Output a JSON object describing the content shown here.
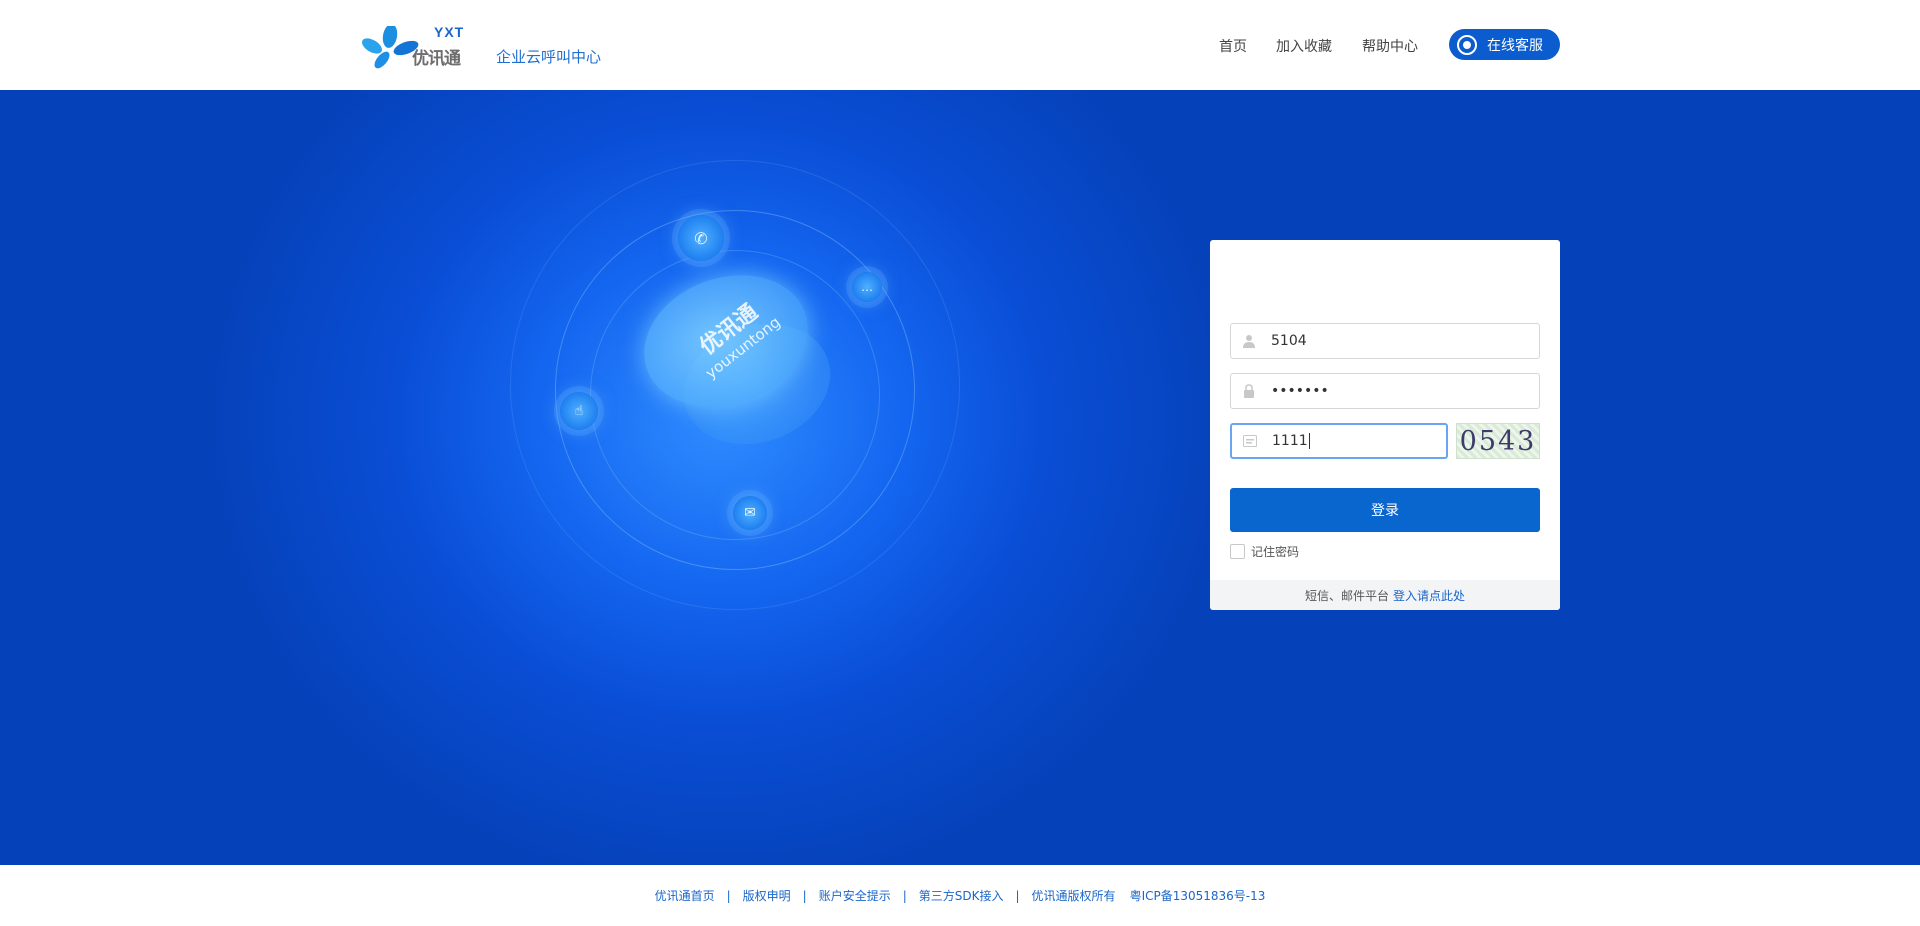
{
  "header": {
    "logo_mark": "YXT",
    "logo_cn": "优讯通",
    "subtitle": "企业云呼叫中心",
    "nav": [
      "首页",
      "加入收藏",
      "帮助中心"
    ],
    "service_button": "在线客服"
  },
  "hero": {
    "brand_cn": "优讯通",
    "brand_en": "youxuntong"
  },
  "login": {
    "username_value": "5104",
    "password_value": "•••••••",
    "captcha_input_value": "1111",
    "captcha_image_text": "0543",
    "submit_label": "登录",
    "remember_label": "记住密码",
    "footer_text": "短信、邮件平台",
    "footer_link": "登入请点此处"
  },
  "footer": {
    "links": [
      "优讯通首页",
      "版权申明",
      "账户安全提示",
      "第三方SDK接入",
      "优讯通版权所有"
    ],
    "icp": "粤ICP备13051836号-13"
  },
  "colors": {
    "brand_blue": "#0a66cf",
    "hero_blue": "#0541b8"
  }
}
